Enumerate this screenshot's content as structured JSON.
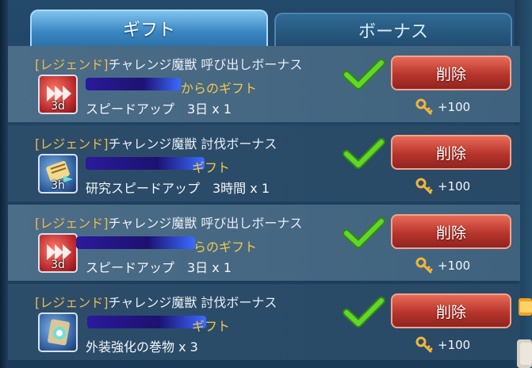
{
  "tabs": [
    {
      "label": "ギフト",
      "active": true
    },
    {
      "label": "ボーナス",
      "active": false
    }
  ],
  "colors": {
    "tag": "#f0b94a",
    "sender": "#f2c84c",
    "delete_button": "#c2412f",
    "check": "#58d021"
  },
  "gifts": [
    {
      "tag": "[レジェンド]",
      "title_rest": "チャレンジ魔獣 呼び出しボーナス",
      "sender": "からのギフト",
      "icon": "speedup-icon",
      "duration": "3d",
      "item": "スピードアップ　3日 x 1",
      "button": "削除",
      "reward": "+100",
      "reward_icon": "key-icon"
    },
    {
      "tag": "[レジェンド]",
      "title_rest": "チャレンジ魔獣 討伐ボーナス",
      "sender": "ギフト",
      "icon": "research-scroll-icon",
      "duration": "3h",
      "item": "研究スピードアップ　3時間 x 1",
      "button": "削除",
      "reward": "+100",
      "reward_icon": "key-icon"
    },
    {
      "tag": "[レジェンド]",
      "title_rest": "チャレンジ魔獣 呼び出しボーナス",
      "sender": "らのギフト",
      "icon": "speedup-icon",
      "duration": "3d",
      "item": "スピードアップ　3日 x 1",
      "button": "削除",
      "reward": "+100",
      "reward_icon": "key-icon"
    },
    {
      "tag": "[レジェンド]",
      "title_rest": "チャレンジ魔獣 討伐ボーナス",
      "sender": "ギフト",
      "icon": "skin-scroll-icon",
      "duration": "",
      "item": "外装強化の巻物 x 3",
      "button": "削除",
      "reward": "+100",
      "reward_icon": "key-icon"
    }
  ]
}
